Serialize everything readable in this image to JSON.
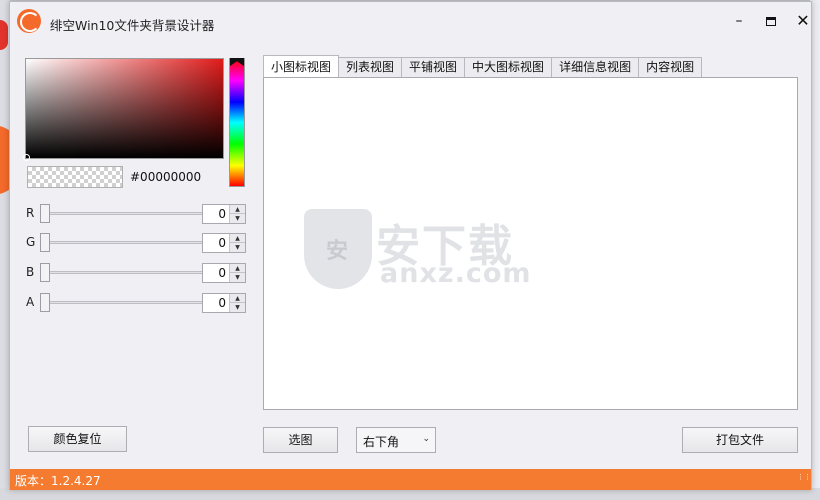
{
  "window": {
    "title": "绯空Win10文件夹背景设计器",
    "logo_icon": "orange-circle-logo",
    "controls": {
      "minimize_icon": "minimize-icon",
      "maximize_icon": "maximize-icon",
      "close_icon": "close-icon"
    }
  },
  "color_picker": {
    "hex": "#00000000",
    "base_hue": "#e11b1b",
    "sliders": [
      {
        "label": "R",
        "value": "0"
      },
      {
        "label": "G",
        "value": "0"
      },
      {
        "label": "B",
        "value": "0"
      },
      {
        "label": "A",
        "value": "0"
      }
    ],
    "reset_label": "颜色复位"
  },
  "tabs": [
    {
      "label": "小图标视图",
      "active": true
    },
    {
      "label": "列表视图",
      "active": false
    },
    {
      "label": "平铺视图",
      "active": false
    },
    {
      "label": "中大图标视图",
      "active": false
    },
    {
      "label": "详细信息视图",
      "active": false
    },
    {
      "label": "内容视图",
      "active": false
    }
  ],
  "watermark": {
    "shield_text": "安",
    "cn": "安下载",
    "en": "anxz.com"
  },
  "actions": {
    "select_image_label": "选图",
    "position_selected": "右下角",
    "pack_label": "打包文件"
  },
  "status": {
    "version_text": "版本：1.2.4.27"
  },
  "colors": {
    "accent": "#f47b2f",
    "logo": "#f46a2a"
  }
}
